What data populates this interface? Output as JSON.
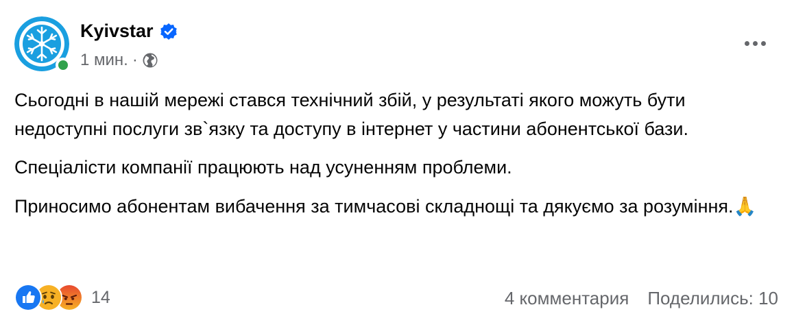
{
  "post": {
    "author": "Kyivstar",
    "time": "1 мин.",
    "separator": "·",
    "paragraphs": [
      "Сьогодні в нашій мережі стався технічний збій, у результаті якого можуть бути недоступні послуги зв`язку та доступу в інтернет у частини абонентської бази.",
      "Спеціалісти компанії працюють над усуненням проблеми.",
      "Приносимо абонентам вибачення за тимчасові складнощі та дякуємо за розуміння."
    ],
    "emoji": "🙏",
    "reactions": {
      "icons": [
        "like-icon",
        "sad-icon",
        "angry-icon"
      ],
      "count": "14"
    },
    "comments_label": "4 комментария",
    "shares_label": "Поделились: 10"
  },
  "colors": {
    "brand_blue": "#1a9fe0",
    "verified_blue": "#0866ff",
    "online_green": "#31a24c",
    "meta_gray": "#65676b"
  }
}
